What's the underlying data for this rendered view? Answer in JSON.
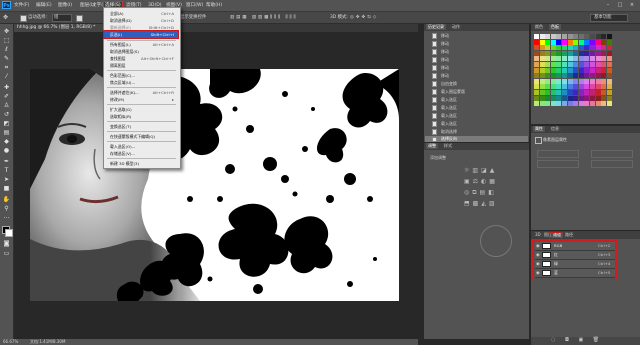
{
  "app": {
    "logo": "Ps"
  },
  "menubar": {
    "items": [
      {
        "label": "文件(F)"
      },
      {
        "label": "编辑(E)"
      },
      {
        "label": "图像(I)"
      },
      {
        "label": "图层(L)"
      },
      {
        "label": "文字(Y)"
      },
      {
        "label": "选择(S)",
        "active": true
      },
      {
        "label": "滤镜(T)"
      },
      {
        "label": "3D(D)"
      },
      {
        "label": "视图(V)"
      },
      {
        "label": "窗口(W)"
      },
      {
        "label": "帮助(H)"
      }
    ],
    "window_controls": [
      "–",
      "□",
      "×"
    ]
  },
  "options_bar": {
    "auto_select": "自动选择:",
    "select_target": "组",
    "transform_controls": "显示变换控件",
    "mode_3d": "3D 模式:",
    "workspace": "基本功能"
  },
  "document": {
    "tab_title": "hhhg.jpg @ 66.7% (图层 1, RGB/8) *"
  },
  "status": {
    "zoom": "66.67%",
    "doc_info": "文档:1.41M/8.30M"
  },
  "select_menu": {
    "items": [
      {
        "label": "全部(A)",
        "shortcut": "Ctrl+A"
      },
      {
        "label": "取消选择(D)",
        "shortcut": "Ctrl+D"
      },
      {
        "label": "重新选择(E)",
        "shortcut": "Shift+Ctrl+D"
      },
      {
        "label": "反选(I)",
        "shortcut": "Shift+Ctrl+I",
        "highlight": true
      },
      {
        "separator": true
      },
      {
        "label": "所有图层(L)",
        "shortcut": "Alt+Ctrl+A"
      },
      {
        "label": "取消选择图层(S)",
        "shortcut": ""
      },
      {
        "label": "查找图层",
        "shortcut": "Alt+Shift+Ctrl+F"
      },
      {
        "label": "隔离图层",
        "shortcut": ""
      },
      {
        "separator": true
      },
      {
        "label": "色彩范围(C)...",
        "shortcut": ""
      },
      {
        "label": "焦点区域(U)...",
        "shortcut": ""
      },
      {
        "separator": true
      },
      {
        "label": "选择并遮住(K)...",
        "shortcut": "Alt+Ctrl+R"
      },
      {
        "label": "修改(M)",
        "shortcut": "▸"
      },
      {
        "separator": true
      },
      {
        "label": "扩大选取(G)",
        "shortcut": ""
      },
      {
        "label": "选取相似(R)",
        "shortcut": ""
      },
      {
        "separator": true
      },
      {
        "label": "变换选区(T)",
        "shortcut": ""
      },
      {
        "separator": true
      },
      {
        "label": "在快速蒙版模式下编辑(Q)",
        "shortcut": ""
      },
      {
        "separator": true
      },
      {
        "label": "载入选区(O)...",
        "shortcut": ""
      },
      {
        "label": "存储选区(V)...",
        "shortcut": ""
      },
      {
        "separator": true
      },
      {
        "label": "新建 3D 模型(3)",
        "shortcut": ""
      }
    ]
  },
  "history": {
    "tabs": [
      "历史记录",
      "动作"
    ],
    "items": [
      {
        "label": "移动"
      },
      {
        "label": "移动"
      },
      {
        "label": "移动"
      },
      {
        "label": "移动"
      },
      {
        "label": "移动"
      },
      {
        "label": "移动"
      },
      {
        "label": "自由变换"
      },
      {
        "label": "载入图层蒙版"
      },
      {
        "label": "载入选区"
      },
      {
        "label": "载入选区"
      },
      {
        "label": "载入选区"
      },
      {
        "label": "载入选区"
      },
      {
        "label": "取消选择"
      },
      {
        "label": "选择反向",
        "selected": true
      }
    ]
  },
  "adjustments": {
    "tabs": [
      "调整",
      "样式"
    ],
    "label": "添加调整"
  },
  "swatches": {
    "tabs": [
      "颜色",
      "色板"
    ]
  },
  "properties": {
    "tabs": [
      "属性",
      "信息"
    ],
    "label": "像素图层属性"
  },
  "layers": {
    "tabs": [
      "3D",
      "图层",
      "通道",
      "路径"
    ],
    "active_tab": "通道",
    "rows": [
      {
        "name": "RGB",
        "shortcut": "Ctrl+2"
      },
      {
        "name": "红",
        "shortcut": "Ctrl+3"
      },
      {
        "name": "绿",
        "shortcut": "Ctrl+4"
      },
      {
        "name": "蓝",
        "shortcut": "Ctrl+5"
      }
    ]
  },
  "icons": [
    "move-icon",
    "marquee-icon",
    "lasso-icon",
    "quick-select-icon",
    "crop-icon",
    "eyedropper-icon",
    "healing-icon",
    "brush-icon",
    "stamp-icon",
    "history-brush-icon",
    "eraser-icon",
    "gradient-icon",
    "blur-icon",
    "dodge-icon",
    "pen-icon",
    "type-icon",
    "path-select-icon",
    "shape-icon",
    "hand-icon",
    "zoom-icon",
    "eye-icon"
  ],
  "colors": {
    "accent_red": "#d01c1c",
    "highlight_blue": "#2d5fc0",
    "panel": "#535353",
    "bg": "#282828"
  }
}
